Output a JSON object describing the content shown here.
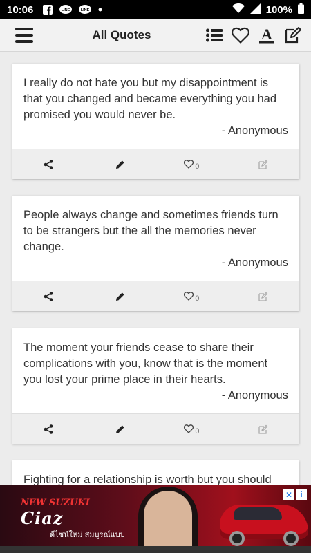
{
  "status_bar": {
    "time": "10:06",
    "battery": "100%",
    "icons": [
      "facebook-icon",
      "line-icon",
      "line-icon",
      "dot-icon",
      "wifi-icon",
      "signal-icon",
      "battery-icon"
    ]
  },
  "app_bar": {
    "title": "All Quotes",
    "actions": [
      "category-list-icon",
      "favorites-heart-icon",
      "font-icon",
      "write-quote-icon"
    ]
  },
  "quotes": [
    {
      "text": "I really do not hate you but my disappointment is that you changed and became everything you had promised you would never be.",
      "author": "- Anonymous",
      "likes": "0"
    },
    {
      "text": "People always change and sometimes friends turn to be strangers but the all the memories never change.",
      "author": "- Anonymous",
      "likes": "0"
    },
    {
      "text": "The moment your friends cease to share their complications with you, know that is the moment you lost your prime place in their hearts.",
      "author": "- Anonymous",
      "likes": "0"
    },
    {
      "text": "Fighting for a relationship is worth but you should",
      "author": "",
      "likes": ""
    }
  ],
  "ad": {
    "brand_new": "NEW SUZUKI",
    "model": "Ciaz",
    "tagline": "ดีไซน์ใหม่ สมบูรณ์แบบ",
    "badge": "i",
    "close": "✕"
  },
  "colors": {
    "status_bar": "#000000",
    "app_bar": "#f2f2f2",
    "card": "#ffffff",
    "toolbar": "#eeeeee",
    "text": "#333333"
  }
}
